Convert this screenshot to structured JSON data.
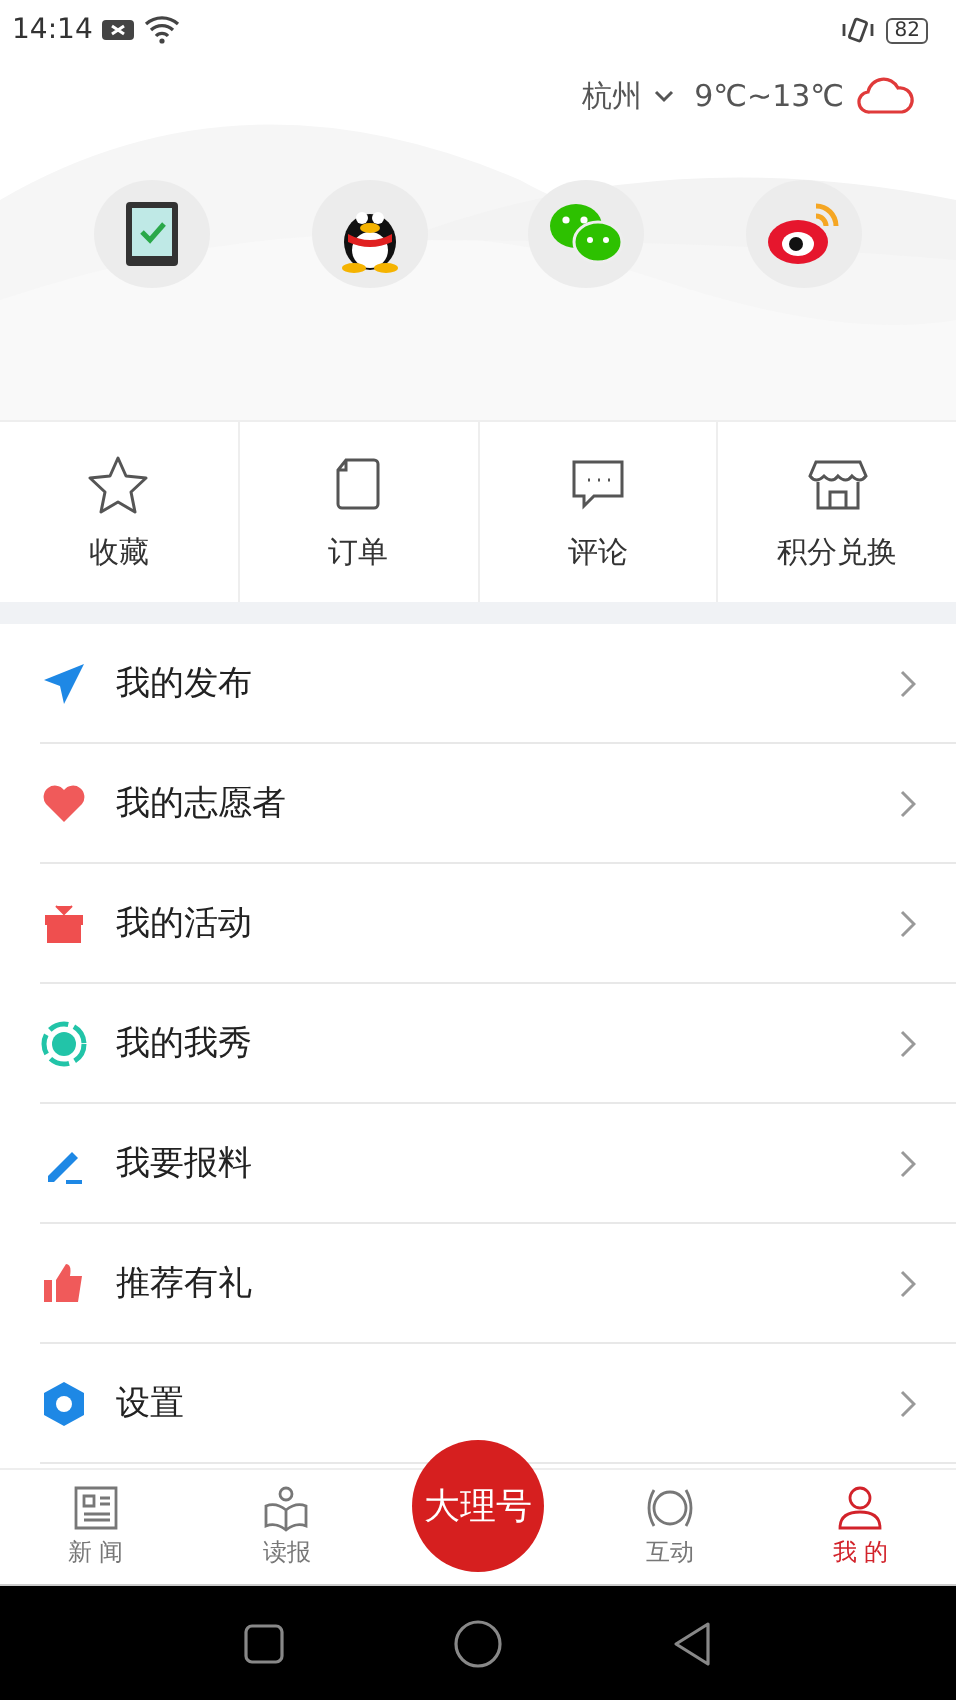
{
  "status_bar": {
    "time": "14:14",
    "battery": "82"
  },
  "weather": {
    "city": "杭州",
    "temperature": "9℃~13℃"
  },
  "login_options": [
    {
      "kind": "phone"
    },
    {
      "kind": "qq"
    },
    {
      "kind": "wechat"
    },
    {
      "kind": "weibo"
    }
  ],
  "shortcuts": [
    {
      "kind": "star",
      "label": "收藏"
    },
    {
      "kind": "note",
      "label": "订单"
    },
    {
      "kind": "comment",
      "label": "评论"
    },
    {
      "kind": "store",
      "label": "积分兑换"
    }
  ],
  "menu": [
    {
      "kind": "send",
      "label": "我的发布",
      "color": "#1e88e5"
    },
    {
      "kind": "heart",
      "label": "我的志愿者",
      "color": "#f05a5a"
    },
    {
      "kind": "gift",
      "label": "我的活动",
      "color": "#ef4f4f"
    },
    {
      "kind": "ring",
      "label": "我的我秀",
      "color": "#22c4a8"
    },
    {
      "kind": "pen",
      "label": "我要报料",
      "color": "#1e88e5"
    },
    {
      "kind": "thumb",
      "label": "推荐有礼",
      "color": "#f05a5a"
    },
    {
      "kind": "hexagon",
      "label": "设置",
      "color": "#1e88e5"
    }
  ],
  "tabs": [
    {
      "kind": "news",
      "label": "新 闻",
      "selected": false
    },
    {
      "kind": "reader",
      "label": "读报",
      "selected": false
    },
    {
      "kind": "center",
      "label": "大理号",
      "selected": false
    },
    {
      "kind": "interact",
      "label": "互动",
      "selected": false
    },
    {
      "kind": "person",
      "label": "我 的",
      "selected": true
    }
  ]
}
